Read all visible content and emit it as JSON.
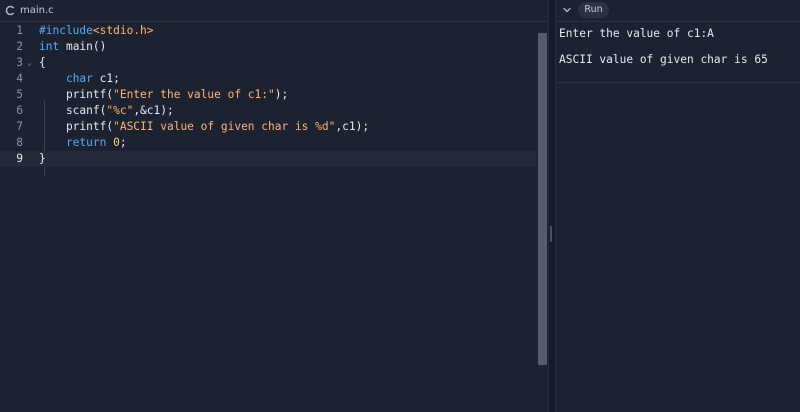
{
  "file_tab": {
    "label": "main.c",
    "icon": "file-c-icon"
  },
  "editor": {
    "lines": [
      {
        "num": "1",
        "tokens": [
          {
            "t": "#include",
            "c": "kw"
          },
          {
            "t": "<stdio.h>",
            "c": "inc"
          }
        ]
      },
      {
        "num": "2",
        "tokens": [
          {
            "t": "int",
            "c": "kw"
          },
          {
            "t": " main()",
            "c": "plain"
          }
        ]
      },
      {
        "num": "3",
        "tokens": [
          {
            "t": "{",
            "c": "plain"
          }
        ],
        "fold": "⌄"
      },
      {
        "num": "4",
        "tokens": [
          {
            "t": "    ",
            "c": "plain"
          },
          {
            "t": "char",
            "c": "kw"
          },
          {
            "t": " c1;",
            "c": "plain"
          }
        ]
      },
      {
        "num": "5",
        "tokens": [
          {
            "t": "    printf(",
            "c": "plain"
          },
          {
            "t": "\"Enter the value of c1:\"",
            "c": "str"
          },
          {
            "t": ");",
            "c": "plain"
          }
        ]
      },
      {
        "num": "6",
        "tokens": [
          {
            "t": "    scanf(",
            "c": "plain"
          },
          {
            "t": "\"%c\"",
            "c": "str"
          },
          {
            "t": ",&c1);",
            "c": "plain"
          }
        ]
      },
      {
        "num": "7",
        "tokens": [
          {
            "t": "    printf(",
            "c": "plain"
          },
          {
            "t": "\"ASCII value of given char is %d\"",
            "c": "str"
          },
          {
            "t": ",c1);",
            "c": "plain"
          }
        ]
      },
      {
        "num": "8",
        "tokens": [
          {
            "t": "    ",
            "c": "plain"
          },
          {
            "t": "return",
            "c": "kw"
          },
          {
            "t": " ",
            "c": "plain"
          },
          {
            "t": "0",
            "c": "num"
          },
          {
            "t": ";",
            "c": "plain"
          }
        ]
      },
      {
        "num": "9",
        "tokens": [
          {
            "t": "}",
            "c": "plain"
          }
        ],
        "current": true
      }
    ]
  },
  "output": {
    "run_label": "Run",
    "collapse_icon": "chevron-down-icon",
    "lines": [
      "Enter the value of c1:A",
      "ASCII value of given char is 65"
    ]
  },
  "colors": {
    "background": "#1c2230",
    "keyword": "#5aa9f5",
    "string": "#ffb37a",
    "number": "#f7d774",
    "text": "#e6e9ef",
    "line_number": "#8b93a3"
  }
}
